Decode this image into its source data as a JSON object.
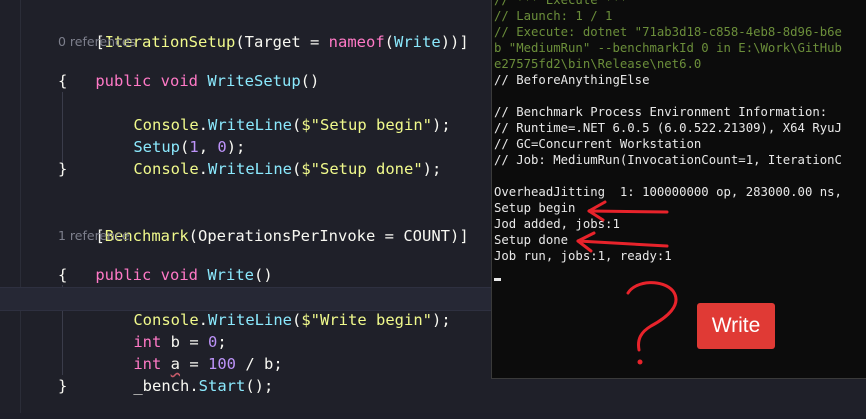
{
  "editor": {
    "lines": {
      "attr1": {
        "open": "[",
        "name": "IterationSetup",
        "p1": "(",
        "prop": "Target",
        "eq": " = ",
        "kw": "nameof",
        "p2": "(",
        "arg": "Write",
        "close": "))]"
      },
      "codelens1": "0 references",
      "sig1": {
        "kw1": "public",
        "kw2": "void",
        "name": "WriteSetup",
        "rest": "()"
      },
      "brace_open1": "{",
      "body1a": {
        "cls": "Console",
        "dot": ".",
        "m": "WriteLine",
        "p": "(",
        "str": "$\"Setup begin\"",
        "end": ");"
      },
      "body1b": {
        "m": "Setup",
        "p": "(",
        "a": "1",
        "c": ", ",
        "b": "0",
        "end": ");"
      },
      "body1c": {
        "cls": "Console",
        "dot": ".",
        "m": "WriteLine",
        "p": "(",
        "str": "$\"Setup done\"",
        "end": ");"
      },
      "brace_close1": "}",
      "attr2": {
        "open": "[",
        "name": "Benchmark",
        "p1": "(",
        "prop": "OperationsPerInvoke",
        "eq": " = ",
        "arg": "COUNT",
        "close": ")]"
      },
      "codelens2": "1 reference",
      "sig2": {
        "kw1": "public",
        "kw2": "void",
        "name": "Write",
        "rest": "()"
      },
      "brace_open2": "{",
      "body2a": {
        "cls": "Console",
        "dot": ".",
        "m": "WriteLine",
        "p": "(",
        "str": "$\"Write begin\"",
        "end": ");"
      },
      "body2b": {
        "kw": "int",
        "var": "b",
        "eq": " = ",
        "num": "0",
        "end": ";"
      },
      "body2c": {
        "kw": "int",
        "var": "a",
        "eq": " = ",
        "num": "100",
        "op": " / ",
        "var2": "b",
        "end": ";"
      },
      "body2d": {
        "obj": "_bench",
        "dot": ".",
        "m": "Start",
        "end": "();"
      },
      "brace_close2": "}"
    }
  },
  "console": {
    "lines": [
      {
        "text": "// *** Execute ***",
        "color": "green"
      },
      {
        "text": "// Launch: 1 / 1",
        "color": "green"
      },
      {
        "text": "// Execute: dotnet \"71ab3d18-c858-4eb8-8d96-b6e",
        "color": "green"
      },
      {
        "text": "b \"MediumRun\" --benchmarkId 0 in E:\\Work\\GitHub",
        "color": "green"
      },
      {
        "text": "e27575fd2\\bin\\Release\\net6.0",
        "color": "green"
      },
      {
        "text": "// BeforeAnythingElse",
        "color": "white"
      },
      {
        "text": "",
        "color": "white"
      },
      {
        "text": "// Benchmark Process Environment Information:",
        "color": "white"
      },
      {
        "text": "// Runtime=.NET 6.0.5 (6.0.522.21309), X64 RyuJ",
        "color": "white"
      },
      {
        "text": "// GC=Concurrent Workstation",
        "color": "white"
      },
      {
        "text": "// Job: MediumRun(InvocationCount=1, IterationC",
        "color": "white"
      },
      {
        "text": "",
        "color": "white"
      },
      {
        "text": "OverheadJitting  1: 100000000 op, 283000.00 ns,",
        "color": "white"
      },
      {
        "text": "Setup begin",
        "color": "white"
      },
      {
        "text": "Jod added, jobs:1",
        "color": "white"
      },
      {
        "text": "Setup done",
        "color": "white"
      },
      {
        "text": "Job run, jobs:1, ready:1",
        "color": "white"
      }
    ],
    "annotation_label": "Write",
    "annotation_question": "?",
    "colors": {
      "arrow": "#e8232b",
      "button": "#e03a35"
    }
  }
}
